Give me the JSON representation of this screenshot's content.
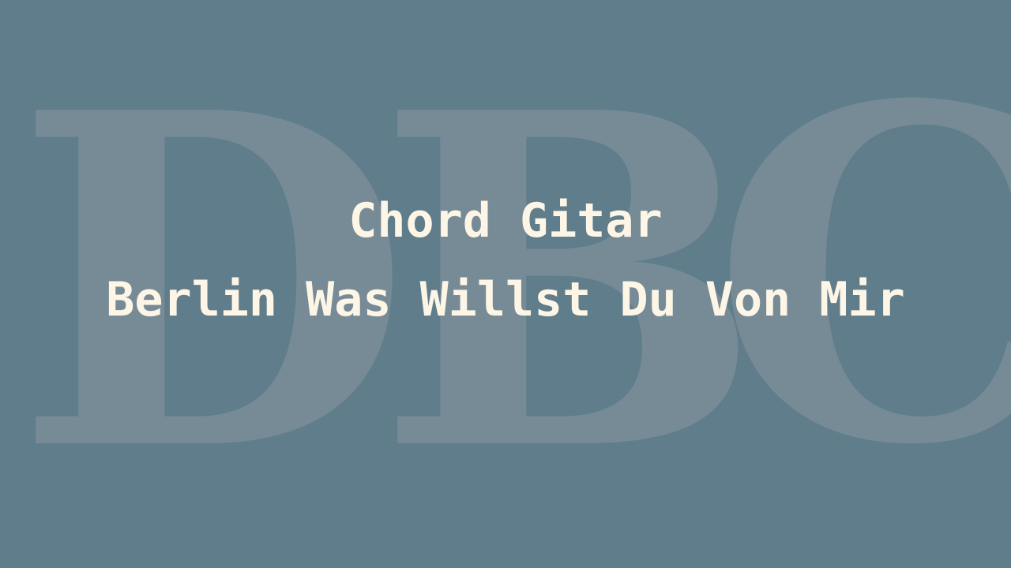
{
  "background_color": "#607d8b",
  "watermark": {
    "letters": [
      "D",
      "B",
      "C"
    ],
    "color": "#778b97"
  },
  "title": {
    "line1": "Chord Gitar",
    "line2": "Berlin Was Willst Du Von Mir",
    "color": "#fdf6e6"
  }
}
